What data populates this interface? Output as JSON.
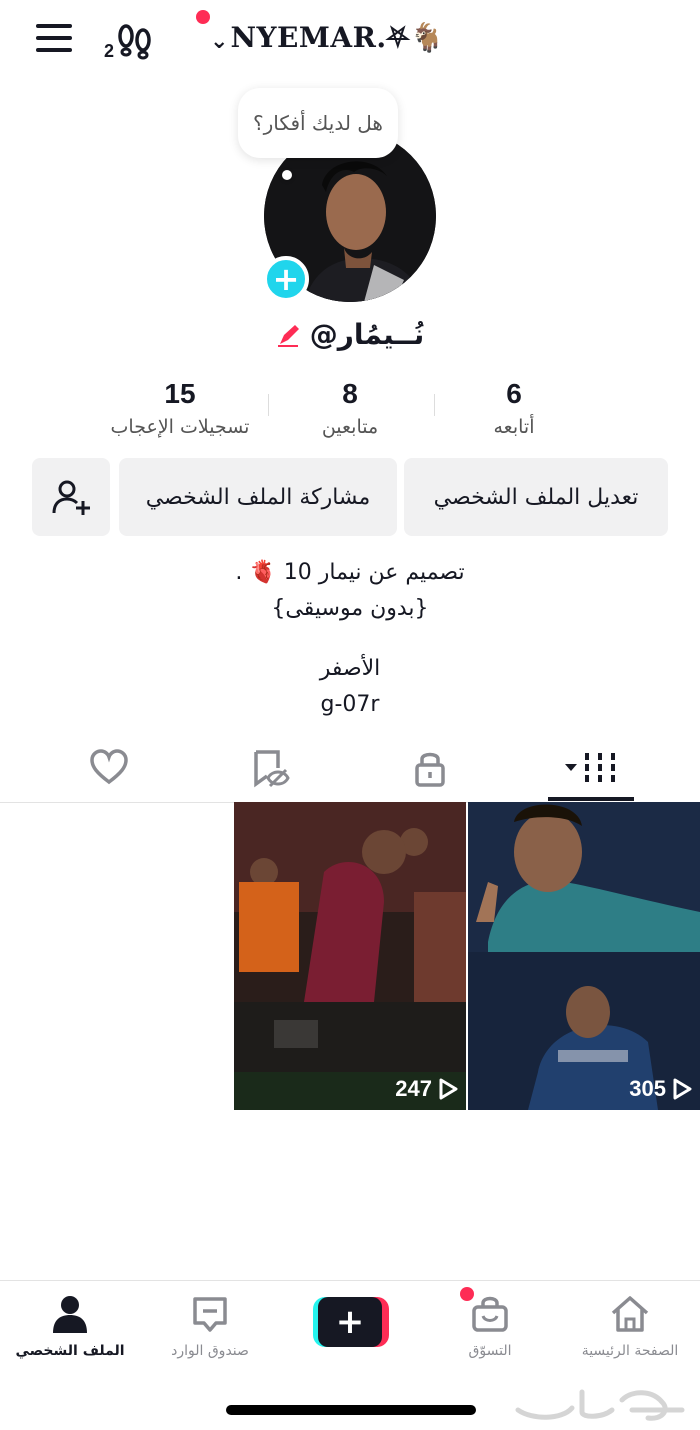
{
  "header": {
    "title": "NYEMAR.⛧🐐",
    "steps_count": "2"
  },
  "profile": {
    "thought_bubble": "هل لديك أفكار؟",
    "username": "@نُــيمُار",
    "avatar_add": "+"
  },
  "stats": [
    {
      "value": "6",
      "label": "أتابعه"
    },
    {
      "value": "8",
      "label": "متابعين"
    },
    {
      "value": "15",
      "label": "تسجيلات الإعجاب"
    }
  ],
  "buttons": {
    "edit_profile": "تعديل الملف الشخصي",
    "share_profile": "مشاركة الملف الشخصي"
  },
  "bio": {
    "line1": "تصميم عن نيمار 10 🫀 .",
    "line2": "{بدون موسيقى}",
    "line3": "الأصفر",
    "line4": "g-07r"
  },
  "tabs": [
    "videos-grid",
    "private",
    "reposts",
    "liked"
  ],
  "videos": [
    {
      "views": "305"
    },
    {
      "views": "247"
    }
  ],
  "bottom_nav": {
    "home": "الصفحة الرئيسية",
    "shop": "التسوّق",
    "create": "+",
    "inbox": "صندوق الوارد",
    "profile": "الملف الشخصي"
  },
  "colors": {
    "accent_red": "#fe2c55",
    "accent_cyan": "#25f4ee",
    "avatar_plus": "#20d5ec"
  }
}
